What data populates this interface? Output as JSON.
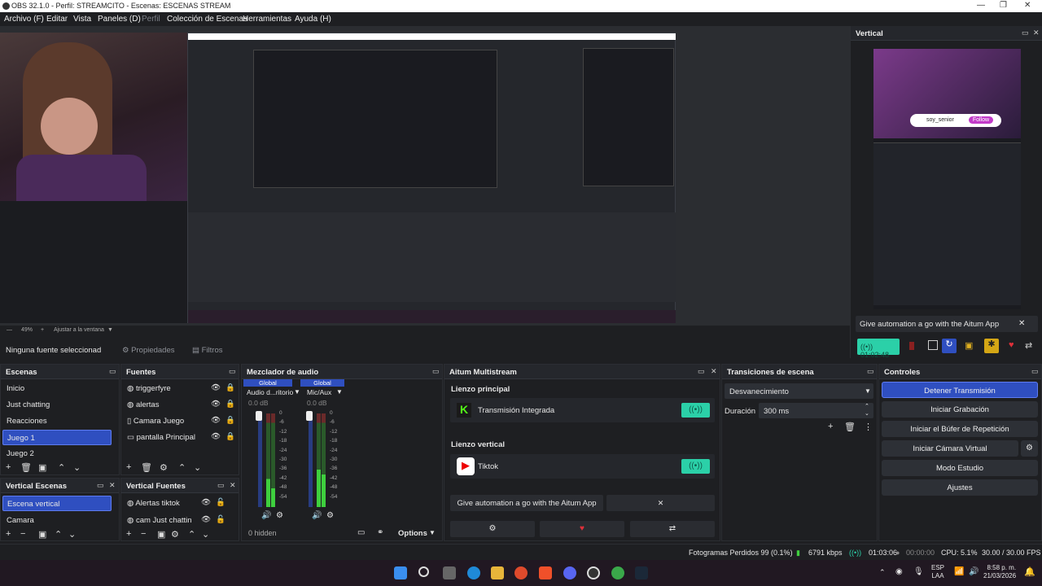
{
  "window": {
    "title": "OBS 32.1.0 - Perfil: STREAMCITO - Escenas: ESCENAS STREAM"
  },
  "menu": [
    "Archivo (F)",
    "Editar",
    "Vista",
    "Paneles (D)",
    "Perfil",
    "Colección de Escenas",
    "Herramientas",
    "Ayuda (H)"
  ],
  "preview": {
    "zoom": "49%",
    "fit": "Ajustar a la ventana"
  },
  "vertical_dock": {
    "title": "Vertical",
    "banner": "Give automation a go with the Aitum App",
    "timer": "01:02:48",
    "overlay_user": "soy_senior",
    "overlay_follow": "Follow"
  },
  "source_bar": {
    "selected": "Ninguna fuente seleccionad",
    "properties": "Propiedades",
    "filters": "Filtros"
  },
  "scenes": {
    "title": "Escenas",
    "items": [
      "Inicio",
      "Just chatting",
      "Reacciones",
      "Juego 1",
      "Juego 2"
    ],
    "selected": "Juego 1"
  },
  "sources": {
    "title": "Fuentes",
    "items": [
      "triggerfyre",
      "alertas",
      "Camara Juego",
      "pantalla Principal"
    ]
  },
  "vertical_scenes": {
    "title": "Vertical Escenas",
    "items": [
      "Escena vertical",
      "Camara"
    ],
    "selected": "Escena vertical"
  },
  "vertical_sources": {
    "title": "Vertical Fuentes",
    "items": [
      "Alertas tiktok",
      "cam Just chattin"
    ]
  },
  "mixer": {
    "title": "Mezclador de audio",
    "channels": [
      {
        "badge": "Global",
        "name": "Audio d...ritorio",
        "db": "0.0 dB"
      },
      {
        "badge": "Global",
        "name": "Mic/Aux",
        "db": "0.0 dB"
      }
    ],
    "scale": [
      "0",
      "-6",
      "-12",
      "-18",
      "-24",
      "-30",
      "-36",
      "-42",
      "-48",
      "-54",
      "-60"
    ],
    "hidden": "0 hidden",
    "options": "Options"
  },
  "aitum": {
    "title": "Aitum Multistream",
    "main_canvas": "Lienzo principal",
    "main_stream": "Transmisión Integrada",
    "vertical_canvas": "Lienzo vertical",
    "vertical_stream": "Tiktok",
    "banner": "Give automation a go with the Aitum App"
  },
  "transitions": {
    "title": "Transiciones de escena",
    "selected": "Desvanecimiento",
    "duration_label": "Duración",
    "duration": "300 ms"
  },
  "controls": {
    "title": "Controles",
    "buttons": [
      "Detener Transmisión",
      "Iniciar Grabación",
      "Iniciar el Búfer de Repetición",
      "Iniciar Cámara Virtual",
      "Modo Estudio",
      "Ajustes"
    ]
  },
  "status": {
    "dropped": "Fotogramas Perdidos 99 (0.1%)",
    "bitrate": "6791 kbps",
    "stream_time": "01:03:06",
    "rec_time": "00:00:00",
    "cpu": "CPU: 5.1%",
    "fps": "30.00 / 30.00 FPS"
  },
  "taskbar": {
    "lang": "ESP",
    "lang2": "LAA",
    "time": "8:58 p. m.",
    "date": "21/03/2026"
  },
  "colors": {
    "accent": "#2f4fc0",
    "accent_border": "#5e7cf0",
    "green": "#2bd0a8",
    "bg": "#1e1f22"
  }
}
